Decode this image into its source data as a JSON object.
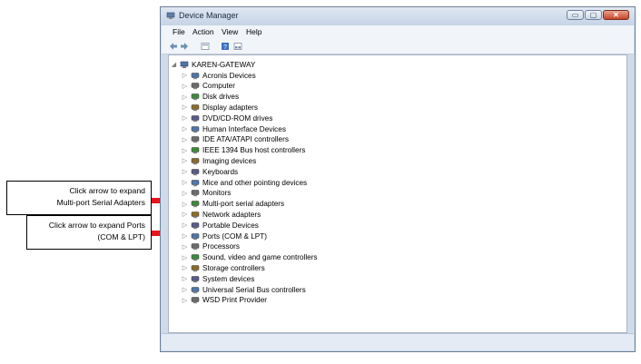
{
  "window": {
    "title": "Device Manager",
    "controls": {
      "minimize": "▭",
      "maximize": "▢",
      "close": "✕"
    }
  },
  "menu": [
    "File",
    "Action",
    "View",
    "Help"
  ],
  "toolbar": [
    "back-icon",
    "forward-icon",
    "properties-icon",
    "help-icon",
    "view-icon"
  ],
  "tree": {
    "root": "KAREN-GATEWAY",
    "items": [
      {
        "label": "Acronis Devices",
        "icon": "device-icon"
      },
      {
        "label": "Computer",
        "icon": "computer-icon"
      },
      {
        "label": "Disk drives",
        "icon": "disk-icon"
      },
      {
        "label": "Display adapters",
        "icon": "display-icon"
      },
      {
        "label": "DVD/CD-ROM drives",
        "icon": "dvd-icon"
      },
      {
        "label": "Human Interface Devices",
        "icon": "hid-icon"
      },
      {
        "label": "IDE ATA/ATAPI controllers",
        "icon": "ide-icon"
      },
      {
        "label": "IEEE 1394 Bus host controllers",
        "icon": "ieee1394-icon"
      },
      {
        "label": "Imaging devices",
        "icon": "camera-icon"
      },
      {
        "label": "Keyboards",
        "icon": "keyboard-icon"
      },
      {
        "label": "Mice and other pointing devices",
        "icon": "mouse-icon"
      },
      {
        "label": "Monitors",
        "icon": "monitor-icon"
      },
      {
        "label": "Multi-port serial adapters",
        "icon": "serial-icon"
      },
      {
        "label": "Network adapters",
        "icon": "network-icon"
      },
      {
        "label": "Portable Devices",
        "icon": "portable-icon"
      },
      {
        "label": "Ports (COM & LPT)",
        "icon": "port-icon"
      },
      {
        "label": "Processors",
        "icon": "processor-icon"
      },
      {
        "label": "Sound, video and game controllers",
        "icon": "sound-icon"
      },
      {
        "label": "Storage controllers",
        "icon": "storage-icon"
      },
      {
        "label": "System devices",
        "icon": "system-icon"
      },
      {
        "label": "Universal Serial Bus controllers",
        "icon": "usb-icon"
      },
      {
        "label": "WSD Print Provider",
        "icon": "printer-icon"
      }
    ]
  },
  "callouts": [
    {
      "line1": "Click arrow to expand",
      "line2": "Multi-port Serial Adapters"
    },
    {
      "line1": "Click arrow to expand Ports",
      "line2": "(COM & LPT)"
    }
  ],
  "colors": {
    "arrow": "#e8141b",
    "window_frame": "#cfdbe9"
  }
}
